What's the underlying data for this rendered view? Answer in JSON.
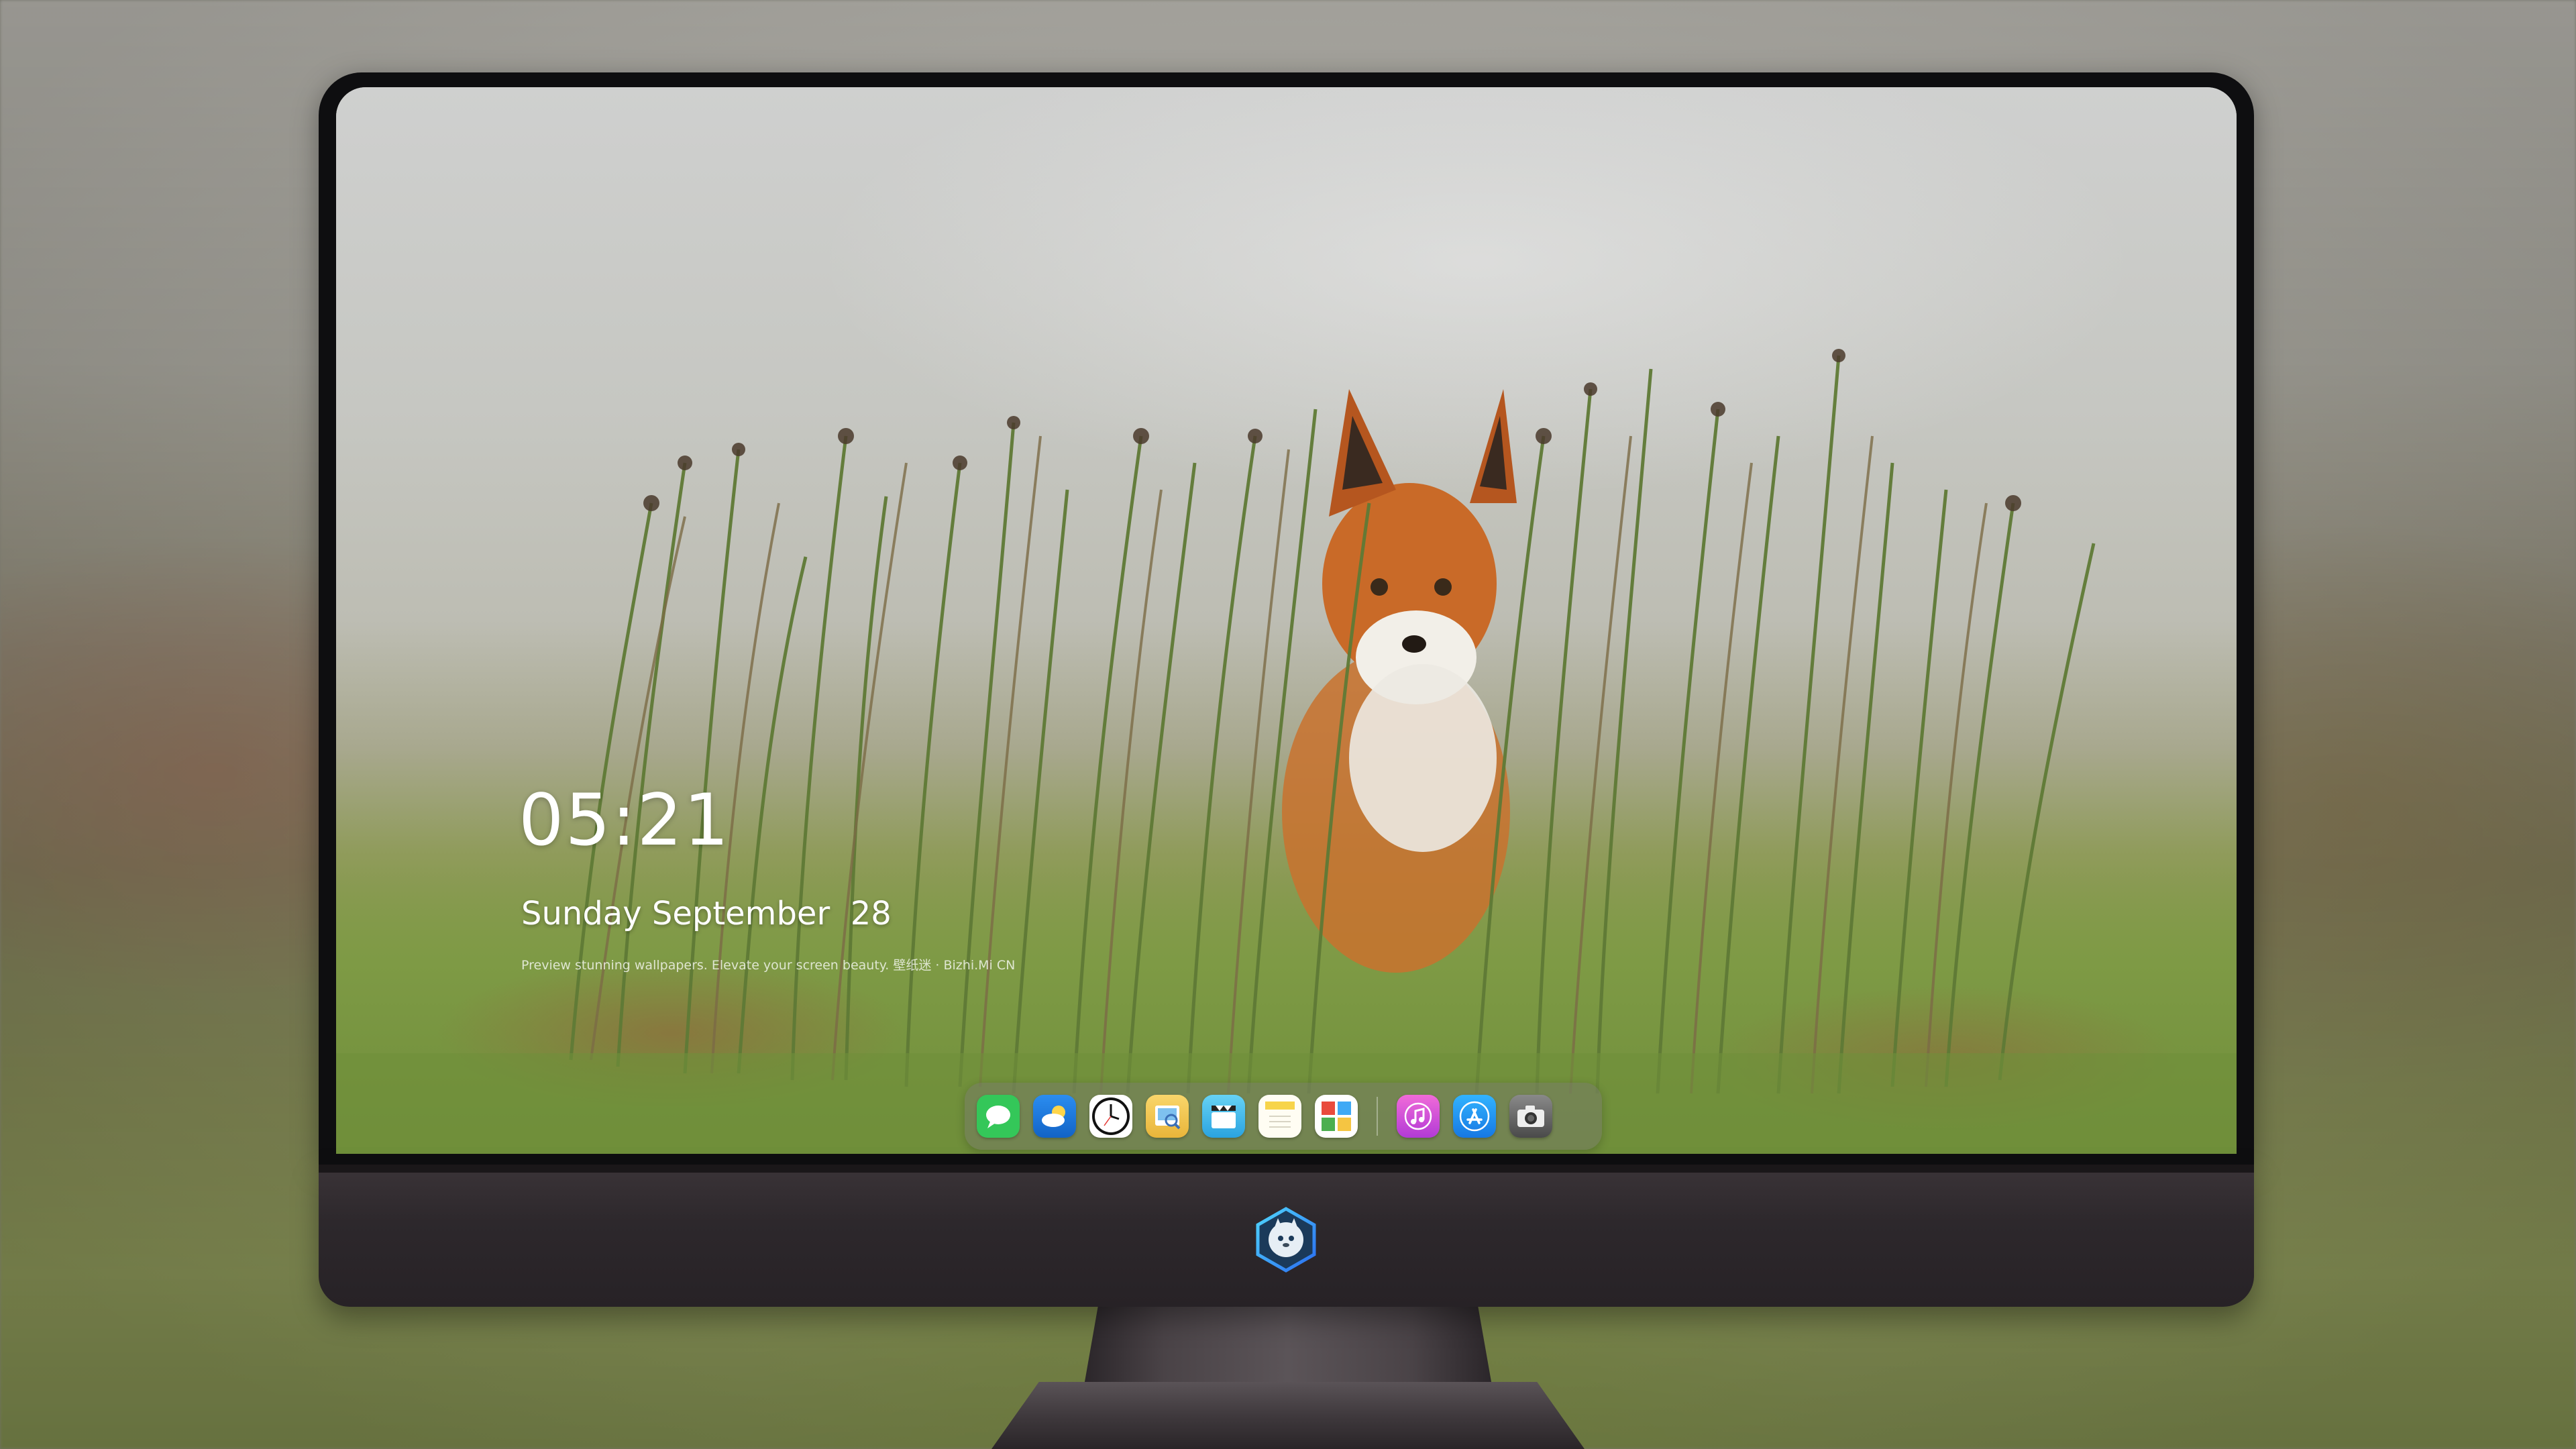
{
  "lock_screen": {
    "time": "05:21",
    "date": "Sunday September  28",
    "tagline": "Preview stunning wallpapers. Elevate your screen beauty. 壁纸迷 · Bizhi.Mi CN"
  },
  "dock": {
    "apps": [
      {
        "name": "Messages",
        "icon": "messages-icon",
        "color": "#34c759"
      },
      {
        "name": "Weather",
        "icon": "weather-icon",
        "color": "#1e88e5"
      },
      {
        "name": "Clock",
        "icon": "clock-icon",
        "color": "#111111"
      },
      {
        "name": "Preview",
        "icon": "preview-icon",
        "color": "#f3c64a"
      },
      {
        "name": "Clips",
        "icon": "clips-icon",
        "color": "#3fb3e6"
      },
      {
        "name": "Notes",
        "icon": "notes-icon",
        "color": "#f7d44a"
      },
      {
        "name": "Photo Booth",
        "icon": "photo-booth-icon",
        "color": "#e94b3c"
      },
      {
        "name": "iTunes",
        "icon": "music-icon",
        "color": "#e24fd0"
      },
      {
        "name": "App Store",
        "icon": "app-store-icon",
        "color": "#1e88e5"
      },
      {
        "name": "Camera",
        "icon": "camera-icon",
        "color": "#5f5f5f"
      }
    ]
  },
  "monitor": {
    "logo_icon": "wallpaper-app-logo-icon",
    "bezel_color": "#0e0e10",
    "chin_color": "#2d282c"
  }
}
